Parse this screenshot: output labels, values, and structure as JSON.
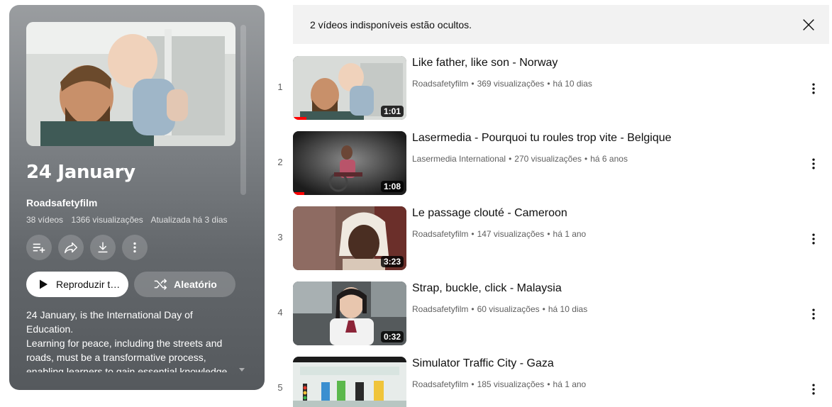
{
  "playlist": {
    "title": "24 January",
    "channel": "Roadsafetyfilm",
    "video_count": "38 vídeos",
    "views": "1366 visualizações",
    "updated": "Atualizada há 3 dias",
    "play_label": "Reproduzir t…",
    "shuffle_label": "Aleatório",
    "description_lines": [
      "24 January, is the International Day of Education.",
      "Learning for peace, including the streets and roads, must be a transformative process, enabling learners to gain essential knowledge"
    ],
    "icons": [
      "add-to-queue-icon",
      "share-icon",
      "download-icon",
      "more-vertical-icon"
    ]
  },
  "notice": {
    "text": "2 vídeos indisponíveis estão ocultos."
  },
  "videos": [
    {
      "index": "1",
      "title": "Like father, like son - Norway",
      "channel": "Roadsafetyfilm",
      "views": "369 visualizações",
      "age": "há 10 dias",
      "duration": "1:01",
      "watched_fraction": 0.12
    },
    {
      "index": "2",
      "title": "Lasermedia - Pourquoi tu roules trop vite - Belgique",
      "channel": "Lasermedia International",
      "views": "270 visualizações",
      "age": "há 6 anos",
      "duration": "1:08",
      "watched_fraction": 0.1
    },
    {
      "index": "3",
      "title": "Le passage clouté - Cameroon",
      "channel": "Roadsafetyfilm",
      "views": "147 visualizações",
      "age": "há 1 ano",
      "duration": "3:23",
      "watched_fraction": 0
    },
    {
      "index": "4",
      "title": "Strap, buckle, click - Malaysia",
      "channel": "Roadsafetyfilm",
      "views": "60 visualizações",
      "age": "há 10 dias",
      "duration": "0:32",
      "watched_fraction": 0
    },
    {
      "index": "5",
      "title": "Simulator Traffic City - Gaza",
      "channel": "Roadsafetyfilm",
      "views": "185 visualizações",
      "age": "há 1 ano",
      "duration": "",
      "watched_fraction": 0
    }
  ],
  "colors": {
    "accent": "#ff0000",
    "panel_dark": "#55595d",
    "notice_bg": "#f2f2f2"
  }
}
